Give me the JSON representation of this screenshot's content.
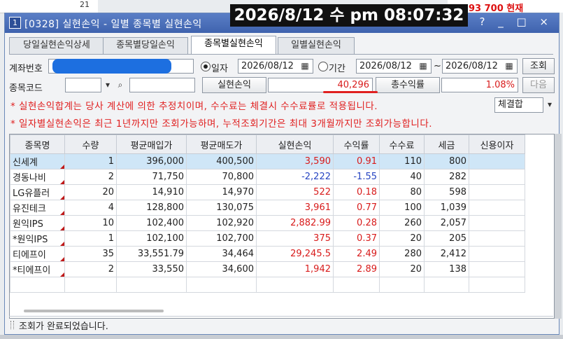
{
  "background": {
    "left_value": "21",
    "right_price": "93 700 현재"
  },
  "overlay_clock": "2026/8/12 수 pm 08:07:32",
  "window": {
    "number": "1",
    "title": "[0328] 실현손익 - 일별 종목별 실현손익",
    "controls": "T ? _ □ ×"
  },
  "tabs": [
    "당일실현손익상세",
    "종목별당일손익",
    "종목별실현손익",
    "일별실현손익"
  ],
  "form": {
    "account_label": "계좌번호",
    "date_radio": "일자",
    "date_value": "2026/08/12",
    "period_radio": "기간",
    "period_from": "2026/08/12",
    "period_sep": "~",
    "period_to": "2026/08/12",
    "search_button": "조회",
    "code_label": "종목코드",
    "realized_label": "실현손익",
    "realized_value": "40,296",
    "return_label": "총수익률",
    "return_value": "1.08%",
    "next_button": "다음",
    "basis_select": "체결합"
  },
  "notes": [
    "* 실현손익합계는 당사 계산에 의한 추정치이며, 수수료는 체결시 수수료률로 적용됩니다.",
    "* 일자별실현손익은 최근 1년까지만 조회가능하며, 누적조회기간은 최대 3개월까지만 조회가능합니다."
  ],
  "table": {
    "headers": [
      "종목명",
      "수량",
      "평균매입가",
      "평균매도가",
      "실현손익",
      "수익률",
      "수수료",
      "세금",
      "신용이자"
    ],
    "rows": [
      {
        "name": "신세계",
        "qty": "1",
        "buy": "396,000",
        "sell": "400,500",
        "pnl": "3,590",
        "rate": "0.91",
        "fee": "110",
        "tax": "800",
        "credit": "",
        "sign": "pos"
      },
      {
        "name": "경동나비",
        "qty": "2",
        "buy": "71,750",
        "sell": "70,800",
        "pnl": "-2,222",
        "rate": "-1.55",
        "fee": "40",
        "tax": "282",
        "credit": "",
        "sign": "neg"
      },
      {
        "name": "LG유플러",
        "qty": "20",
        "buy": "14,910",
        "sell": "14,970",
        "pnl": "522",
        "rate": "0.18",
        "fee": "80",
        "tax": "598",
        "credit": "",
        "sign": "pos"
      },
      {
        "name": "유진테크",
        "qty": "4",
        "buy": "128,800",
        "sell": "130,075",
        "pnl": "3,961",
        "rate": "0.77",
        "fee": "100",
        "tax": "1,039",
        "credit": "",
        "sign": "pos"
      },
      {
        "name": "원익IPS",
        "qty": "10",
        "buy": "102,400",
        "sell": "102,920",
        "pnl": "2,882.99",
        "rate": "0.28",
        "fee": "260",
        "tax": "2,057",
        "credit": "",
        "sign": "pos"
      },
      {
        "name": "*원익IPS",
        "qty": "1",
        "buy": "102,100",
        "sell": "102,700",
        "pnl": "375",
        "rate": "0.37",
        "fee": "20",
        "tax": "205",
        "credit": "",
        "sign": "pos"
      },
      {
        "name": "티에프이",
        "qty": "35",
        "buy": "33,551.79",
        "sell": "34,464",
        "pnl": "29,245.5",
        "rate": "2.49",
        "fee": "280",
        "tax": "2,412",
        "credit": "",
        "sign": "pos"
      },
      {
        "name": "*티에프이",
        "qty": "2",
        "buy": "33,550",
        "sell": "34,600",
        "pnl": "1,942",
        "rate": "2.89",
        "fee": "20",
        "tax": "138",
        "credit": "",
        "sign": "pos"
      }
    ]
  },
  "status": "조회가 완료되었습니다.",
  "colors": {
    "title_bar": "#4a6fbb",
    "positive": "#d81b1b",
    "negative": "#2745c2",
    "notice": "#e02020",
    "selected_row": "#cfe6f7"
  }
}
